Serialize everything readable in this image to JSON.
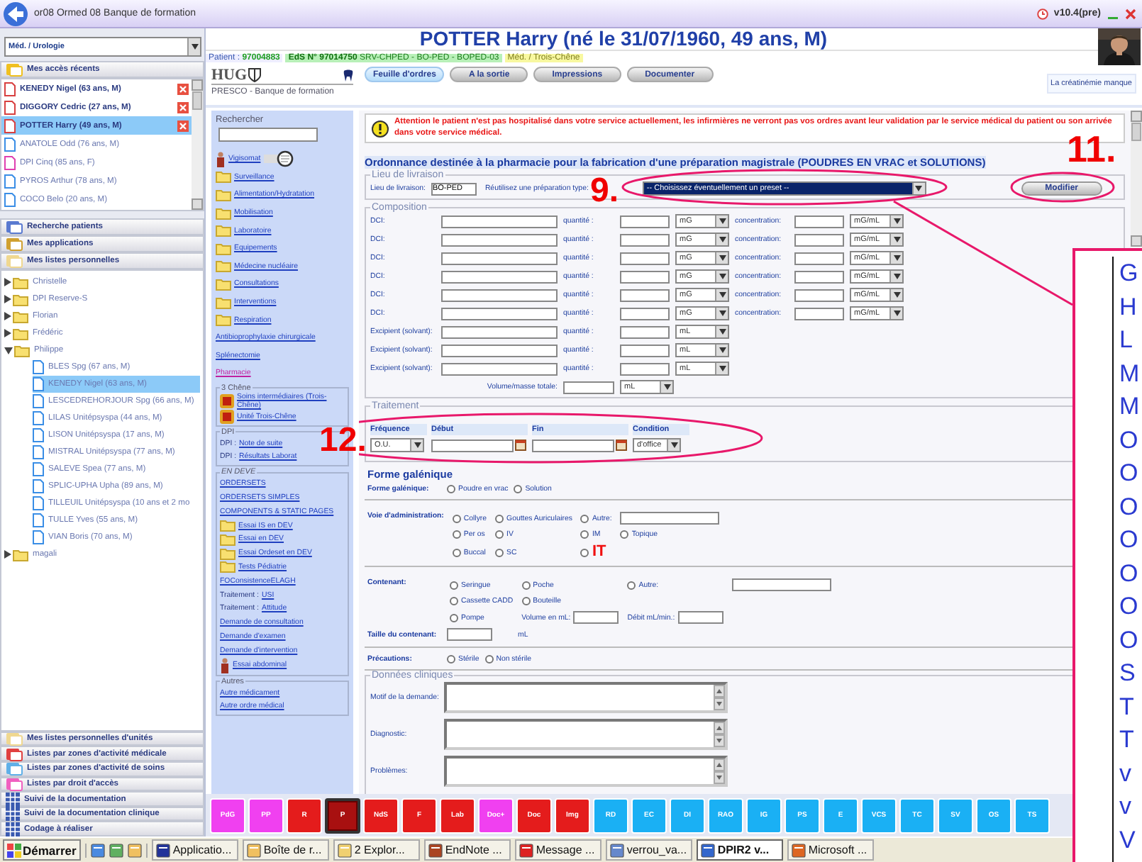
{
  "window": {
    "title": "or08 Ormed 08 Banque de formation",
    "version": "v10.4(pre)"
  },
  "patient": {
    "name": "POTTER Harry (né le 31/07/1960, 49 ans, M)",
    "patient_label": "Patient :",
    "patient_id": "97004883",
    "stay_id": "EdS N° 97014750",
    "stay_unit": "SRV-CHPED - BO-PED - BOPED-03",
    "unit": "Méd. / Trois-Chêne"
  },
  "sidebar": {
    "unit_select": "Méd. / Urologie",
    "recent_header": "Mes accès récents",
    "recent": [
      {
        "label": "KENEDY Nigel (63 ans, M)",
        "pinned": true,
        "selected": false,
        "color": "#d84040"
      },
      {
        "label": "DIGGORY Cedric (27 ans, M)",
        "pinned": true,
        "selected": false,
        "color": "#d84040"
      },
      {
        "label": "POTTER Harry (49 ans, M)",
        "pinned": true,
        "selected": true,
        "color": "#d84040"
      },
      {
        "label": "ANATOLE Odd (76 ans, M)",
        "pinned": false,
        "selected": false,
        "color": "#3a8ee6"
      },
      {
        "label": "DPI Cinq (85 ans, F)",
        "pinned": false,
        "selected": false,
        "color": "#e040b0"
      },
      {
        "label": "PYROS Arthur (78 ans, M)",
        "pinned": false,
        "selected": false,
        "color": "#3a8ee6"
      },
      {
        "label": "COCO Belo (20 ans, M)",
        "pinned": false,
        "selected": false,
        "color": "#3a8ee6"
      }
    ],
    "sections": [
      {
        "label": "Recherche patients",
        "kind": "search"
      },
      {
        "label": "Mes applications",
        "kind": "apps"
      },
      {
        "label": "Mes listes personnelles",
        "kind": "list"
      }
    ],
    "tree": [
      {
        "kind": "folder",
        "label": "Christelle",
        "expanded": false,
        "selected": false
      },
      {
        "kind": "folder",
        "label": "DPI Reserve-S",
        "expanded": false,
        "selected": false
      },
      {
        "kind": "folder",
        "label": "Florian",
        "expanded": false,
        "selected": false
      },
      {
        "kind": "folder",
        "label": "Frédéric",
        "expanded": false,
        "selected": false
      },
      {
        "kind": "folder",
        "label": "Philippe",
        "expanded": true,
        "selected": false,
        "children": [
          {
            "kind": "patient",
            "label": "BLES Spg (67 ans, M)",
            "selected": false
          },
          {
            "kind": "patient",
            "label": "KENEDY Nigel (63 ans, M)",
            "selected": true
          },
          {
            "kind": "patient",
            "label": "LESCEDREHORJOUR Spg (66 ans, M)",
            "selected": false
          },
          {
            "kind": "patient",
            "label": "LILAS Unitépsyspa (44 ans, M)",
            "selected": false
          },
          {
            "kind": "patient",
            "label": "LISON Unitépsyspa (17 ans, M)",
            "selected": false
          },
          {
            "kind": "patient",
            "label": "MISTRAL Unitépsyspa (77 ans, M)",
            "selected": false
          },
          {
            "kind": "patient",
            "label": "SALEVE Spea (77 ans, M)",
            "selected": false
          },
          {
            "kind": "patient",
            "label": "SPLIC-UPHA Upha (89 ans, M)",
            "selected": false
          },
          {
            "kind": "patient",
            "label": "TILLEUIL Unitépsyspa (10 ans et 2 mo",
            "selected": false
          },
          {
            "kind": "patient",
            "label": "TULLE Yves (55 ans, M)",
            "selected": false
          },
          {
            "kind": "patient",
            "label": "VIAN Boris (70 ans, M)",
            "selected": false
          }
        ]
      },
      {
        "kind": "folder",
        "label": "magali",
        "expanded": false,
        "selected": false
      }
    ],
    "bottom_sections": [
      {
        "label": "Mes listes personnelles d'unités",
        "kind": "list"
      },
      {
        "label": "Listes par zones d'activité médicale",
        "kind": "red"
      },
      {
        "label": "Listes par zones d'activité de soins",
        "kind": "blue"
      },
      {
        "label": "Listes par droit d'accès",
        "kind": "pink"
      },
      {
        "label": "Suivi de la documentation",
        "kind": "grid"
      },
      {
        "label": "Suivi de la documentation clinique",
        "kind": "grid"
      },
      {
        "label": "Codage à réaliser",
        "kind": "grid"
      }
    ]
  },
  "header": {
    "logo": "HUG",
    "subtitle": "PRESCO - Banque de formation",
    "alert": "La créatinémie manque",
    "tabs": [
      {
        "label": "Feuille d'ordres",
        "selected": true
      },
      {
        "label": "A la sortie",
        "selected": false
      },
      {
        "label": "Impressions",
        "selected": false
      },
      {
        "label": "Documenter",
        "selected": false
      }
    ]
  },
  "nav": {
    "search_label": "Rechercher",
    "top": [
      {
        "kind": "person",
        "label": "Vigisomat",
        "visited": false
      },
      {
        "kind": "folder",
        "label": "Surveillance",
        "visited": false
      },
      {
        "kind": "folder",
        "label": "Alimentation/Hydratation",
        "visited": false
      },
      {
        "kind": "folder",
        "label": "Mobilisation",
        "visited": false
      },
      {
        "kind": "folder",
        "label": "Laboratoire",
        "visited": false
      },
      {
        "kind": "folder",
        "label": "Equipements",
        "visited": false
      },
      {
        "kind": "folder",
        "label": "Médecine nucléaire",
        "visited": false
      },
      {
        "kind": "folder",
        "label": "Consultations",
        "visited": false
      },
      {
        "kind": "folder",
        "label": "Interventions",
        "visited": false
      },
      {
        "kind": "folder",
        "label": "Respiration",
        "visited": false
      },
      {
        "kind": "link",
        "label": "Antibioprophylaxie chirurgicale",
        "visited": false
      },
      {
        "kind": "link",
        "label": "Splénectomie",
        "visited": false
      },
      {
        "kind": "link",
        "label": "Pharmacie",
        "visited": true
      }
    ],
    "groups": [
      {
        "title": "3 Chêne",
        "items": [
          {
            "kind": "unit",
            "label": "Soins intermédiaires (Trois-Chêne)",
            "visited": false
          },
          {
            "kind": "unit",
            "label": "Unité Trois-Chêne",
            "visited": false
          }
        ]
      },
      {
        "title": "DPI",
        "items": [
          {
            "kind": "prefixed",
            "prefix": "DPI :",
            "label": "Note de suite",
            "visited": false
          },
          {
            "kind": "prefixed",
            "prefix": "DPI :",
            "label": "Résultats Laborat",
            "visited": false
          }
        ]
      },
      {
        "title": "EN DEVE",
        "items": [
          {
            "kind": "link",
            "label": "ORDERSETS",
            "visited": false
          },
          {
            "kind": "link",
            "label": "ORDERSETS SIMPLES",
            "visited": false
          },
          {
            "kind": "link",
            "label": "COMPONENTS & STATIC PAGES",
            "visited": false
          },
          {
            "kind": "folder",
            "label": "Essai IS en DEV",
            "visited": false
          },
          {
            "kind": "folder",
            "label": "Essai en DEV",
            "visited": false
          },
          {
            "kind": "folder",
            "label": "Essai Ordeset en DEV",
            "visited": false
          },
          {
            "kind": "folder",
            "label": "Tests Pédiatrie",
            "visited": false
          },
          {
            "kind": "link",
            "label": "FOConsistenceELAGH",
            "visited": false
          },
          {
            "kind": "prefixed",
            "prefix": "Traitement :",
            "label": "USI",
            "visited": false
          },
          {
            "kind": "prefixed",
            "prefix": "Traitement :",
            "label": "Attitude",
            "visited": false
          },
          {
            "kind": "link",
            "label": "Demande de consultation",
            "visited": false
          },
          {
            "kind": "link",
            "label": "Demande d'examen",
            "visited": false
          },
          {
            "kind": "link",
            "label": "Demande d'intervention",
            "visited": false
          },
          {
            "kind": "person",
            "label": "Essai abdominal",
            "visited": false
          }
        ]
      },
      {
        "title": "Autres",
        "items": [
          {
            "kind": "link",
            "label": "Autre médicament",
            "visited": false
          },
          {
            "kind": "link",
            "label": "Autre ordre médical",
            "visited": false
          }
        ]
      }
    ]
  },
  "form": {
    "warning": "Attention le patient n'est pas hospitalisé dans votre service actuellement, les infirmières ne verront pas vos ordres avant leur validation par le service médical du patient ou son arrivée dans votre service médical.",
    "title": "Ordonnance destinée à la pharmacie pour la fabrication d'une préparation magistrale (POUDRES EN VRAC et SOLUTIONS)",
    "delivery": {
      "legend": "Lieu de livraison",
      "label": "Lieu de livraison:",
      "value": "BO-PED",
      "preset_label": "Réutilisez une préparation type:",
      "preset_value": "-- Choisissez éventuellement un preset --",
      "button": "Modifier"
    },
    "composition": {
      "legend": "Composition",
      "rows": [
        {
          "kind": "dci",
          "label": "DCI:",
          "qty_label": "quantité :",
          "unit": "mG",
          "conc_label": "concentration:",
          "conc_unit": "mG/mL"
        },
        {
          "kind": "dci",
          "label": "DCI:",
          "qty_label": "quantité :",
          "unit": "mG",
          "conc_label": "concentration:",
          "conc_unit": "mG/mL"
        },
        {
          "kind": "dci",
          "label": "DCI:",
          "qty_label": "quantité :",
          "unit": "mG",
          "conc_label": "concentration:",
          "conc_unit": "mG/mL"
        },
        {
          "kind": "dci",
          "label": "DCI:",
          "qty_label": "quantité :",
          "unit": "mG",
          "conc_label": "concentration:",
          "conc_unit": "mG/mL"
        },
        {
          "kind": "dci",
          "label": "DCI:",
          "qty_label": "quantité :",
          "unit": "mG",
          "conc_label": "concentration:",
          "conc_unit": "mG/mL"
        },
        {
          "kind": "dci",
          "label": "DCI:",
          "qty_label": "quantité :",
          "unit": "mG",
          "conc_label": "concentration:",
          "conc_unit": "mG/mL"
        },
        {
          "kind": "excipient",
          "label": "Excipient (solvant):",
          "qty_label": "quantité :",
          "unit": "mL"
        },
        {
          "kind": "excipient",
          "label": "Excipient (solvant):",
          "qty_label": "quantité :",
          "unit": "mL"
        },
        {
          "kind": "excipient",
          "label": "Excipient (solvant):",
          "qty_label": "quantité :",
          "unit": "mL"
        },
        {
          "kind": "total",
          "label": "Volume/masse totale:",
          "unit": "mL"
        }
      ]
    },
    "treatment": {
      "legend": "Traitement",
      "columns": [
        "Fréquence",
        "Début",
        "Fin",
        "Condition"
      ],
      "frequency": "O.U.",
      "condition": "d'office"
    },
    "galenic": {
      "heading": "Forme galénique",
      "label": "Forme galénique:",
      "options": [
        {
          "label": "Poudre en vrac",
          "selected": false
        },
        {
          "label": "Solution",
          "selected": false
        }
      ]
    },
    "route": {
      "label": "Voie d'administration:",
      "rows": [
        [
          {
            "kind": "radio",
            "label": "Collyre",
            "selected": false,
            "highlighted": false
          },
          {
            "kind": "radio",
            "label": "Gouttes Auriculaires",
            "selected": false,
            "highlighted": false
          },
          {
            "kind": "other",
            "label": "Autre:",
            "selected": false,
            "highlighted": false
          }
        ],
        [
          {
            "kind": "radio",
            "label": "Per os",
            "selected": false,
            "highlighted": false
          },
          {
            "kind": "radio",
            "label": "IV",
            "selected": false,
            "highlighted": false
          },
          {
            "kind": "radio",
            "label": "IM",
            "selected": false,
            "highlighted": false
          },
          {
            "kind": "radio",
            "label": "Topique",
            "selected": false,
            "highlighted": false
          }
        ],
        [
          {
            "kind": "radio",
            "label": "Buccal",
            "selected": false,
            "highlighted": false
          },
          {
            "kind": "radio",
            "label": "SC",
            "selected": false,
            "highlighted": false
          },
          {
            "kind": "radio",
            "label": "IT",
            "selected": false,
            "highlighted": true
          }
        ]
      ]
    },
    "container": {
      "label": "Contenant:",
      "rows": [
        [
          {
            "kind": "radio",
            "label": "Seringue",
            "selected": false,
            "highlighted": false
          },
          {
            "kind": "radio",
            "label": "Poche",
            "selected": false,
            "highlighted": false
          },
          {
            "kind": "other",
            "label": "Autre:",
            "selected": false,
            "highlighted": false
          }
        ],
        [
          {
            "kind": "radio",
            "label": "Cassette CADD",
            "selected": false,
            "highlighted": false
          },
          {
            "kind": "radio",
            "label": "Bouteille",
            "selected": false,
            "highlighted": false
          }
        ],
        [
          {
            "kind": "radio",
            "label": "Pompe",
            "selected": false,
            "highlighted": false
          },
          {
            "kind": "field",
            "label": "Volume en mL:"
          },
          {
            "kind": "field",
            "label": "Débit mL/min.:"
          }
        ]
      ],
      "size_label": "Taille du contenant:",
      "size_unit": "mL"
    },
    "precautions": {
      "label": "Précautions:",
      "options": [
        {
          "label": "Stérile",
          "selected": false
        },
        {
          "label": "Non stérile",
          "selected": false
        }
      ]
    },
    "clinical": {
      "legend": "Données cliniques",
      "fields": [
        "Motif de la demande:",
        "Diagnostic:",
        "Problèmes:"
      ]
    }
  },
  "buttons": [
    {
      "label": "PdG",
      "color": "#f040f0",
      "selected": false
    },
    {
      "label": "PP",
      "color": "#f040f0",
      "selected": false
    },
    {
      "label": "R",
      "color": "#e41c1c",
      "selected": false
    },
    {
      "label": "P",
      "color": "#a81010",
      "selected": true
    },
    {
      "label": "NdS",
      "color": "#e41c1c",
      "selected": false
    },
    {
      "label": "F",
      "color": "#e41c1c",
      "selected": false
    },
    {
      "label": "Lab",
      "color": "#e41c1c",
      "selected": false
    },
    {
      "label": "Doc+",
      "color": "#f040f0",
      "selected": false
    },
    {
      "label": "Doc",
      "color": "#e41c1c",
      "selected": false
    },
    {
      "label": "Img",
      "color": "#e41c1c",
      "selected": false
    },
    {
      "label": "RD",
      "color": "#1ab0f4",
      "selected": false
    },
    {
      "label": "EC",
      "color": "#1ab0f4",
      "selected": false
    },
    {
      "label": "DI",
      "color": "#1ab0f4",
      "selected": false
    },
    {
      "label": "RAO",
      "color": "#1ab0f4",
      "selected": false
    },
    {
      "label": "IG",
      "color": "#1ab0f4",
      "selected": false
    },
    {
      "label": "PS",
      "color": "#1ab0f4",
      "selected": false
    },
    {
      "label": "E",
      "color": "#1ab0f4",
      "selected": false
    },
    {
      "label": "VCS",
      "color": "#1ab0f4",
      "selected": false
    },
    {
      "label": "TC",
      "color": "#1ab0f4",
      "selected": false
    },
    {
      "label": "SV",
      "color": "#1ab0f4",
      "selected": false
    },
    {
      "label": "OS",
      "color": "#1ab0f4",
      "selected": false
    },
    {
      "label": "TS",
      "color": "#1ab0f4",
      "selected": false
    }
  ],
  "taskbar": {
    "start": "Démarrer",
    "items": [
      {
        "label": "Applicatio...",
        "selected": false
      },
      {
        "label": "Boîte de r...",
        "selected": false
      },
      {
        "label": "2 Explor...",
        "selected": false
      },
      {
        "label": "EndNote ...",
        "selected": false
      },
      {
        "label": "Message ...",
        "selected": false
      },
      {
        "label": "verrou_va...",
        "selected": false
      },
      {
        "label": "DPIR2 v...",
        "selected": true
      },
      {
        "label": "Microsoft ...",
        "selected": false
      }
    ]
  },
  "annotations": {
    "numbers": [
      "9.",
      "11.",
      "12."
    ],
    "callout": [
      "G",
      "H",
      "L",
      "M",
      "M",
      "O",
      "O",
      "O",
      "O",
      "O",
      "O",
      "O",
      "S",
      "T",
      "T",
      "v",
      "v",
      "V"
    ]
  }
}
